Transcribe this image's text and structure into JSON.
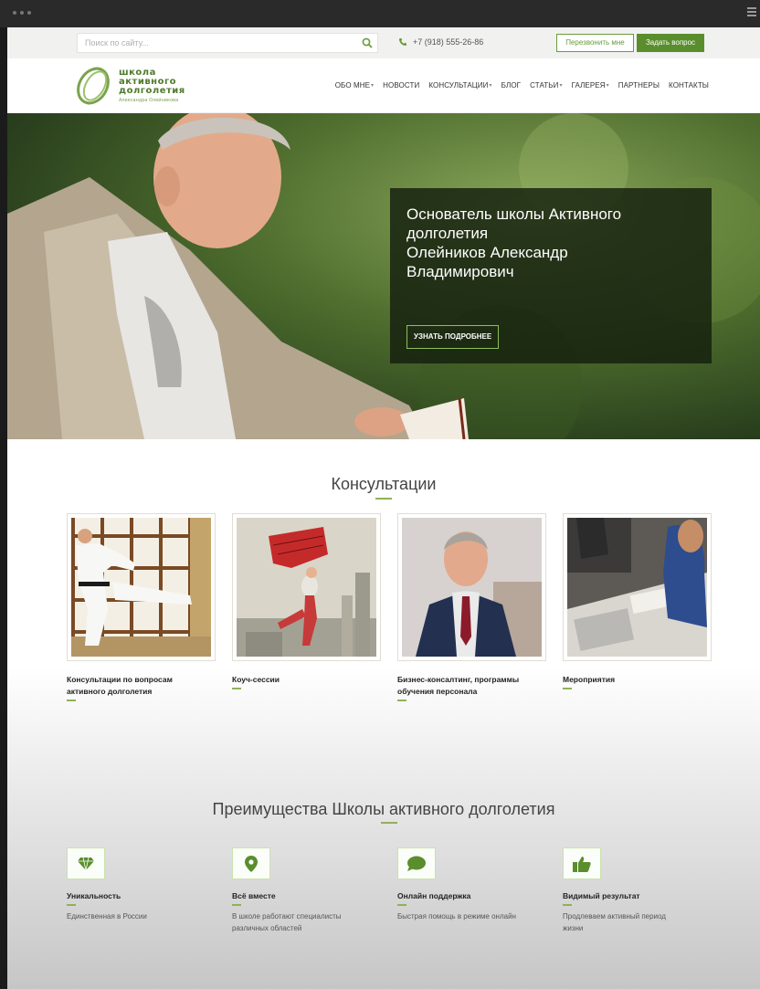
{
  "topbar": {
    "search_placeholder": "Поиск по сайту...",
    "phone": "+7 (918) 555-26-86",
    "callback_button": "Перезвонить мне",
    "ask_button": "Задать вопрос"
  },
  "logo": {
    "line1": "школа",
    "line2": "активного",
    "line3": "долголетия",
    "subtitle": "Александра Олейникова"
  },
  "nav": [
    {
      "label": "ОБО МНЕ",
      "dropdown": true
    },
    {
      "label": "НОВОСТИ",
      "dropdown": false
    },
    {
      "label": "КОНСУЛЬТАЦИИ",
      "dropdown": true
    },
    {
      "label": "БЛОГ",
      "dropdown": false
    },
    {
      "label": "СТАТЬИ",
      "dropdown": true
    },
    {
      "label": "ГАЛЕРЕЯ",
      "dropdown": true
    },
    {
      "label": "ПАРТНЕРЫ",
      "dropdown": false
    },
    {
      "label": "КОНТАКТЫ",
      "dropdown": false
    }
  ],
  "hero": {
    "line1": "Основатель школы Активного",
    "line2": "долголетия",
    "line3": "Олейников Александр",
    "line4": "Владимирович",
    "button": "УЗНАТЬ ПОДРОБНЕЕ"
  },
  "consultations": {
    "title": "Консультации",
    "cards": [
      {
        "caption_1": "Консультации по вопросам",
        "caption_2": "активного долголетия"
      },
      {
        "caption_1": "Коуч-сессии",
        "caption_2": ""
      },
      {
        "caption_1": "Бизнес-консалтинг, программы",
        "caption_2": "обучения персонала"
      },
      {
        "caption_1": "Мероприятия",
        "caption_2": ""
      }
    ]
  },
  "advantages": {
    "title": "Преимущества Школы активного долголетия",
    "items": [
      {
        "title": "Уникальность",
        "desc_1": "Единственная в России",
        "desc_2": "",
        "icon": "diamond-icon"
      },
      {
        "title": "Всё вместе",
        "desc_1": "В школе работают специалисты",
        "desc_2": "различных областей",
        "icon": "map-pin-icon"
      },
      {
        "title": "Онлайн поддержка",
        "desc_1": "Быстрая помощь в режиме онлайн",
        "desc_2": "",
        "icon": "chat-bubble-icon"
      },
      {
        "title": "Видимый результат",
        "desc_1": "Продлеваем активный период",
        "desc_2": "жизни",
        "icon": "thumbs-up-icon"
      }
    ]
  },
  "colors": {
    "accent": "#5a8e2c",
    "accent_light": "#8fb15b",
    "hero_box": "#141e0e"
  }
}
